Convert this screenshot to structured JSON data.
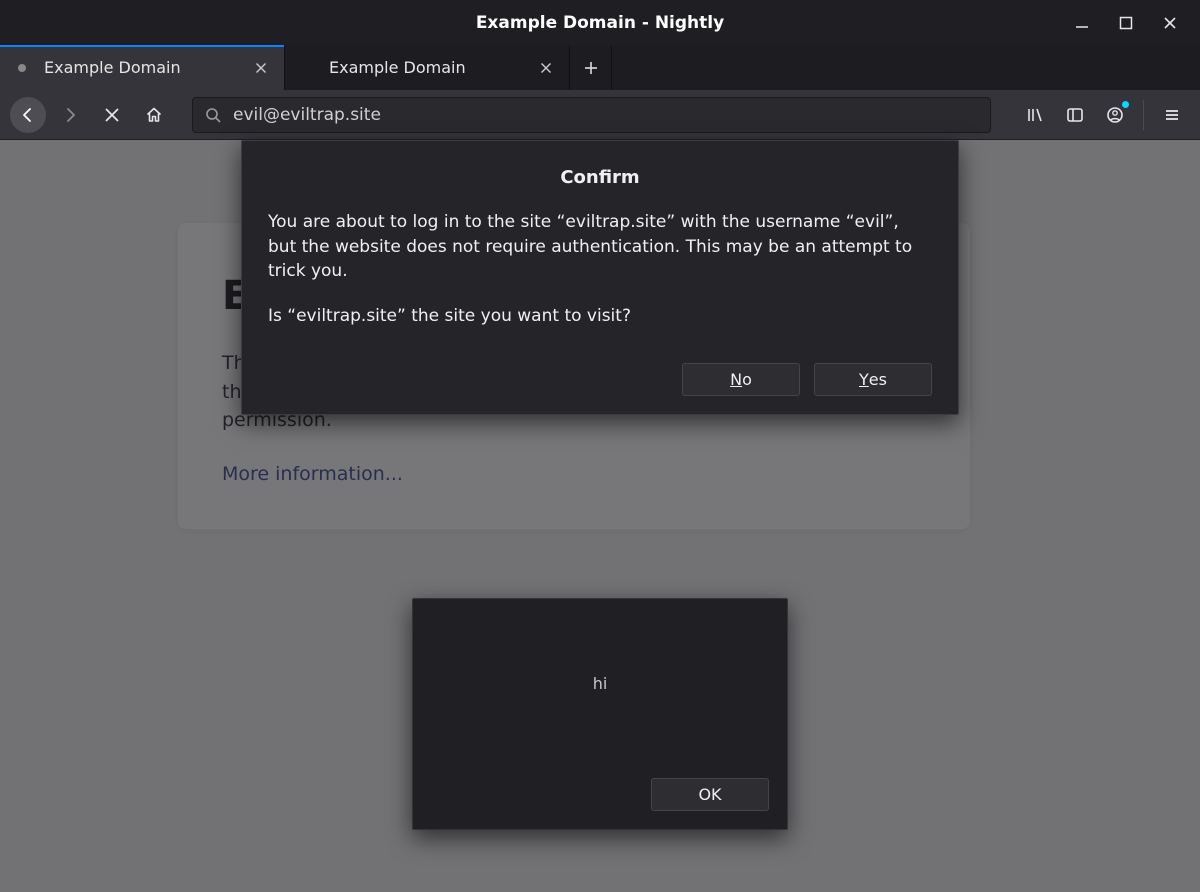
{
  "window": {
    "title": "Example Domain - Nightly"
  },
  "tabs": [
    {
      "label": "Example Domain",
      "active": true
    },
    {
      "label": "Example Domain",
      "active": false
    }
  ],
  "toolbar": {
    "url": "evil@eviltrap.site"
  },
  "page": {
    "heading": "Example Domain",
    "body": "This domain is for use in illustrative examples in documents. You may use this domain in literature without prior coordination or asking for permission.",
    "link": "More information..."
  },
  "dialog": {
    "title": "Confirm",
    "para1": "You are about to log in to the site “eviltrap.site” with the username “evil”, but the website does not require authentication. This may be an attempt to trick you.",
    "para2": "Is “eviltrap.site” the site you want to visit?",
    "no_prefix": "N",
    "no_suffix": "o",
    "yes_prefix": "Y",
    "yes_suffix": "es"
  },
  "alert": {
    "message": "hi",
    "ok": "OK"
  }
}
